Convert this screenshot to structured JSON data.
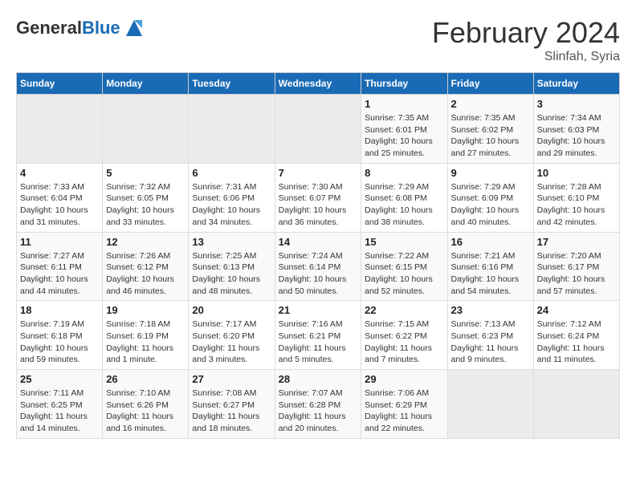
{
  "header": {
    "logo_general": "General",
    "logo_blue": "Blue",
    "month_year": "February 2024",
    "location": "Slinfah, Syria"
  },
  "weekdays": [
    "Sunday",
    "Monday",
    "Tuesday",
    "Wednesday",
    "Thursday",
    "Friday",
    "Saturday"
  ],
  "weeks": [
    [
      {
        "day": "",
        "sunrise": "",
        "sunset": "",
        "daylight": "",
        "empty": true
      },
      {
        "day": "",
        "sunrise": "",
        "sunset": "",
        "daylight": "",
        "empty": true
      },
      {
        "day": "",
        "sunrise": "",
        "sunset": "",
        "daylight": "",
        "empty": true
      },
      {
        "day": "",
        "sunrise": "",
        "sunset": "",
        "daylight": "",
        "empty": true
      },
      {
        "day": "1",
        "sunrise": "Sunrise: 7:35 AM",
        "sunset": "Sunset: 6:01 PM",
        "daylight": "Daylight: 10 hours and 25 minutes."
      },
      {
        "day": "2",
        "sunrise": "Sunrise: 7:35 AM",
        "sunset": "Sunset: 6:02 PM",
        "daylight": "Daylight: 10 hours and 27 minutes."
      },
      {
        "day": "3",
        "sunrise": "Sunrise: 7:34 AM",
        "sunset": "Sunset: 6:03 PM",
        "daylight": "Daylight: 10 hours and 29 minutes."
      }
    ],
    [
      {
        "day": "4",
        "sunrise": "Sunrise: 7:33 AM",
        "sunset": "Sunset: 6:04 PM",
        "daylight": "Daylight: 10 hours and 31 minutes."
      },
      {
        "day": "5",
        "sunrise": "Sunrise: 7:32 AM",
        "sunset": "Sunset: 6:05 PM",
        "daylight": "Daylight: 10 hours and 33 minutes."
      },
      {
        "day": "6",
        "sunrise": "Sunrise: 7:31 AM",
        "sunset": "Sunset: 6:06 PM",
        "daylight": "Daylight: 10 hours and 34 minutes."
      },
      {
        "day": "7",
        "sunrise": "Sunrise: 7:30 AM",
        "sunset": "Sunset: 6:07 PM",
        "daylight": "Daylight: 10 hours and 36 minutes."
      },
      {
        "day": "8",
        "sunrise": "Sunrise: 7:29 AM",
        "sunset": "Sunset: 6:08 PM",
        "daylight": "Daylight: 10 hours and 38 minutes."
      },
      {
        "day": "9",
        "sunrise": "Sunrise: 7:29 AM",
        "sunset": "Sunset: 6:09 PM",
        "daylight": "Daylight: 10 hours and 40 minutes."
      },
      {
        "day": "10",
        "sunrise": "Sunrise: 7:28 AM",
        "sunset": "Sunset: 6:10 PM",
        "daylight": "Daylight: 10 hours and 42 minutes."
      }
    ],
    [
      {
        "day": "11",
        "sunrise": "Sunrise: 7:27 AM",
        "sunset": "Sunset: 6:11 PM",
        "daylight": "Daylight: 10 hours and 44 minutes."
      },
      {
        "day": "12",
        "sunrise": "Sunrise: 7:26 AM",
        "sunset": "Sunset: 6:12 PM",
        "daylight": "Daylight: 10 hours and 46 minutes."
      },
      {
        "day": "13",
        "sunrise": "Sunrise: 7:25 AM",
        "sunset": "Sunset: 6:13 PM",
        "daylight": "Daylight: 10 hours and 48 minutes."
      },
      {
        "day": "14",
        "sunrise": "Sunrise: 7:24 AM",
        "sunset": "Sunset: 6:14 PM",
        "daylight": "Daylight: 10 hours and 50 minutes."
      },
      {
        "day": "15",
        "sunrise": "Sunrise: 7:22 AM",
        "sunset": "Sunset: 6:15 PM",
        "daylight": "Daylight: 10 hours and 52 minutes."
      },
      {
        "day": "16",
        "sunrise": "Sunrise: 7:21 AM",
        "sunset": "Sunset: 6:16 PM",
        "daylight": "Daylight: 10 hours and 54 minutes."
      },
      {
        "day": "17",
        "sunrise": "Sunrise: 7:20 AM",
        "sunset": "Sunset: 6:17 PM",
        "daylight": "Daylight: 10 hours and 57 minutes."
      }
    ],
    [
      {
        "day": "18",
        "sunrise": "Sunrise: 7:19 AM",
        "sunset": "Sunset: 6:18 PM",
        "daylight": "Daylight: 10 hours and 59 minutes."
      },
      {
        "day": "19",
        "sunrise": "Sunrise: 7:18 AM",
        "sunset": "Sunset: 6:19 PM",
        "daylight": "Daylight: 11 hours and 1 minute."
      },
      {
        "day": "20",
        "sunrise": "Sunrise: 7:17 AM",
        "sunset": "Sunset: 6:20 PM",
        "daylight": "Daylight: 11 hours and 3 minutes."
      },
      {
        "day": "21",
        "sunrise": "Sunrise: 7:16 AM",
        "sunset": "Sunset: 6:21 PM",
        "daylight": "Daylight: 11 hours and 5 minutes."
      },
      {
        "day": "22",
        "sunrise": "Sunrise: 7:15 AM",
        "sunset": "Sunset: 6:22 PM",
        "daylight": "Daylight: 11 hours and 7 minutes."
      },
      {
        "day": "23",
        "sunrise": "Sunrise: 7:13 AM",
        "sunset": "Sunset: 6:23 PM",
        "daylight": "Daylight: 11 hours and 9 minutes."
      },
      {
        "day": "24",
        "sunrise": "Sunrise: 7:12 AM",
        "sunset": "Sunset: 6:24 PM",
        "daylight": "Daylight: 11 hours and 11 minutes."
      }
    ],
    [
      {
        "day": "25",
        "sunrise": "Sunrise: 7:11 AM",
        "sunset": "Sunset: 6:25 PM",
        "daylight": "Daylight: 11 hours and 14 minutes."
      },
      {
        "day": "26",
        "sunrise": "Sunrise: 7:10 AM",
        "sunset": "Sunset: 6:26 PM",
        "daylight": "Daylight: 11 hours and 16 minutes."
      },
      {
        "day": "27",
        "sunrise": "Sunrise: 7:08 AM",
        "sunset": "Sunset: 6:27 PM",
        "daylight": "Daylight: 11 hours and 18 minutes."
      },
      {
        "day": "28",
        "sunrise": "Sunrise: 7:07 AM",
        "sunset": "Sunset: 6:28 PM",
        "daylight": "Daylight: 11 hours and 20 minutes."
      },
      {
        "day": "29",
        "sunrise": "Sunrise: 7:06 AM",
        "sunset": "Sunset: 6:29 PM",
        "daylight": "Daylight: 11 hours and 22 minutes."
      },
      {
        "day": "",
        "sunrise": "",
        "sunset": "",
        "daylight": "",
        "empty": true
      },
      {
        "day": "",
        "sunrise": "",
        "sunset": "",
        "daylight": "",
        "empty": true
      }
    ]
  ]
}
